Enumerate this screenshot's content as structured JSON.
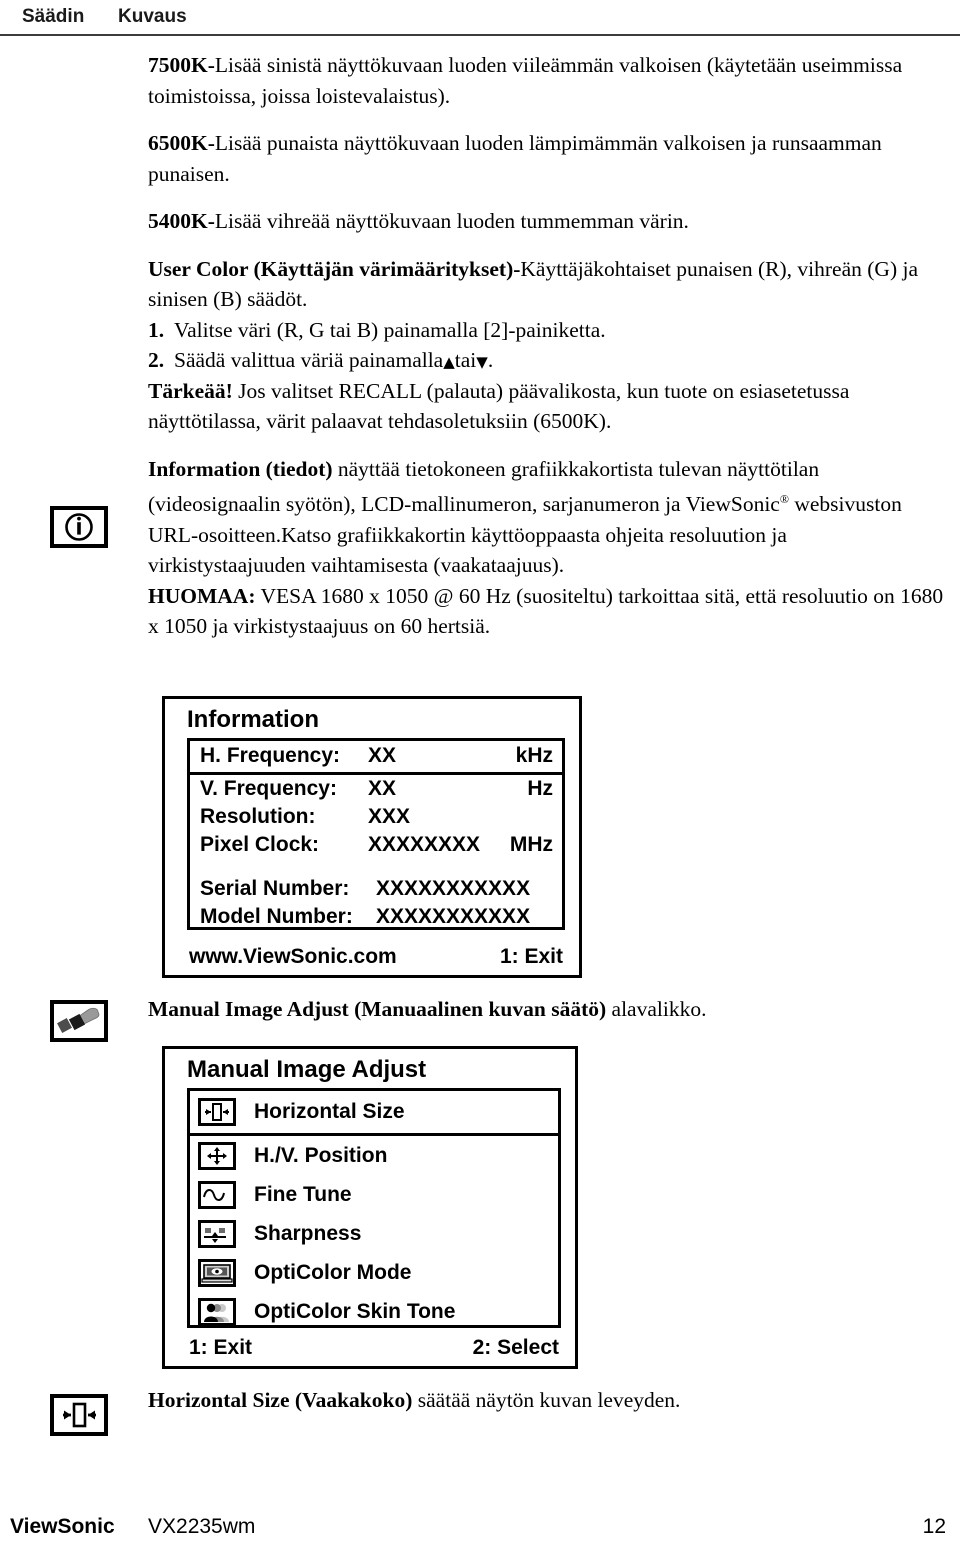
{
  "header": {
    "col_control": "Säädin",
    "col_description": "Kuvaus"
  },
  "content": {
    "p_7500k_bold": "7500K-",
    "p_7500k_rest": "Lisää sinistä näyttökuvaan luoden viileämmän valkoisen (käytetään useimmissa toimistoissa, joissa loistevalaistus).",
    "p_6500k_bold": "6500K-",
    "p_6500k_rest": "Lisää punaista näyttökuvaan luoden lämpimämmän valkoisen ja runsaamman punaisen.",
    "p_5400k_bold": "5400K-",
    "p_5400k_rest": "Lisää vihreää näyttökuvaan luoden tummemman värin.",
    "p_usercolor_bold": "User Color (Käyttäjän värimääritykset)-",
    "p_usercolor_rest": "Käyttäjäkohtaiset punaisen (R), vihreän (G) ja sinisen (B) säädöt.",
    "step_1_num": "1.",
    "step_1_text": "Valitse väri (R, G tai B) painamalla [2]-painiketta.",
    "step_2_num": "2.",
    "step_2_text_a": "Säädä valittua väriä painamalla",
    "step_2_up_glyph": "▲",
    "step_2_text_b": "tai",
    "step_2_down_glyph": "▼",
    "step_2_text_c": ".",
    "p_tarkeaa_bold": "Tärkeää!",
    "p_tarkeaa_rest": " Jos valitset RECALL (palauta) päävalikosta, kun tuote on esiasetetussa näyttötilassa, värit palaavat tehdasoletuksiin (6500K).",
    "p_information_bold": "Information (tiedot)",
    "p_information_rest_a": " näyttää tietokoneen grafiikkakortista tulevan näyttötilan (videosignaalin syötön), LCD-mallinumeron, sarjanumeron ja ViewSonic",
    "p_information_sup": "®",
    "p_information_rest_b": " websivuston URL-osoitteen.Katso grafiikkakortin käyttöoppaasta ohjeita resoluution ja virkistystaajuuden vaihtamisesta (vaakataajuus).",
    "p_huomaa_bold": "HUOMAA:",
    "p_huomaa_rest": " VESA 1680 x 1050 @ 60 Hz (suositeltu) tarkoittaa sitä, että resoluutio on 1680 x 1050 ja virkistystaajuus on 60 hertsiä.",
    "p_manual_bold": "Manual Image Adjust (Manuaalinen kuvan säätö)",
    "p_manual_rest": " alavalikko.",
    "p_hsize_bold": "Horizontal Size (Vaakakoko)",
    "p_hsize_rest": " säätää näytön kuvan leveyden."
  },
  "margin_icons": {
    "information": "information-icon",
    "manual_image_adjust": "wrench-tool-icon",
    "horizontal_size": "horizontal-size-icon"
  },
  "info_panel": {
    "title": "Information",
    "rows": [
      {
        "label": "H. Frequency:",
        "value": "XX",
        "unit": "kHz",
        "highlighted": true
      },
      {
        "label": "V. Frequency:",
        "value": "XX",
        "unit": "Hz",
        "highlighted": false
      },
      {
        "label": "Resolution:",
        "value": "XXX",
        "unit": "",
        "highlighted": false
      },
      {
        "label": "Pixel Clock:",
        "value": "XXXXXXXX",
        "unit": "MHz",
        "highlighted": false
      }
    ],
    "rows2": [
      {
        "label": "Serial Number:",
        "value": "XXXXXXXXXXX"
      },
      {
        "label": "Model Number:",
        "value": "XXXXXXXXXXX"
      }
    ],
    "footer_left": "www.ViewSonic.com",
    "footer_right": "1: Exit"
  },
  "manual_panel": {
    "title": "Manual Image Adjust",
    "items": [
      {
        "label": "Horizontal Size",
        "icon": "horizontal-size-icon",
        "highlighted": true
      },
      {
        "label": "H./V. Position",
        "icon": "hv-position-icon",
        "highlighted": false
      },
      {
        "label": "Fine Tune",
        "icon": "fine-tune-icon",
        "highlighted": false
      },
      {
        "label": "Sharpness",
        "icon": "sharpness-icon",
        "highlighted": false
      },
      {
        "label": "OptiColor Mode",
        "icon": "opticolor-mode-icon",
        "highlighted": false
      },
      {
        "label": "OptiColor Skin Tone",
        "icon": "opticolor-skin-tone-icon",
        "highlighted": false
      }
    ],
    "footer_left": "1: Exit",
    "footer_right": "2: Select"
  },
  "footer": {
    "brand": "ViewSonic",
    "model": "VX2235wm",
    "page_number": "12"
  }
}
